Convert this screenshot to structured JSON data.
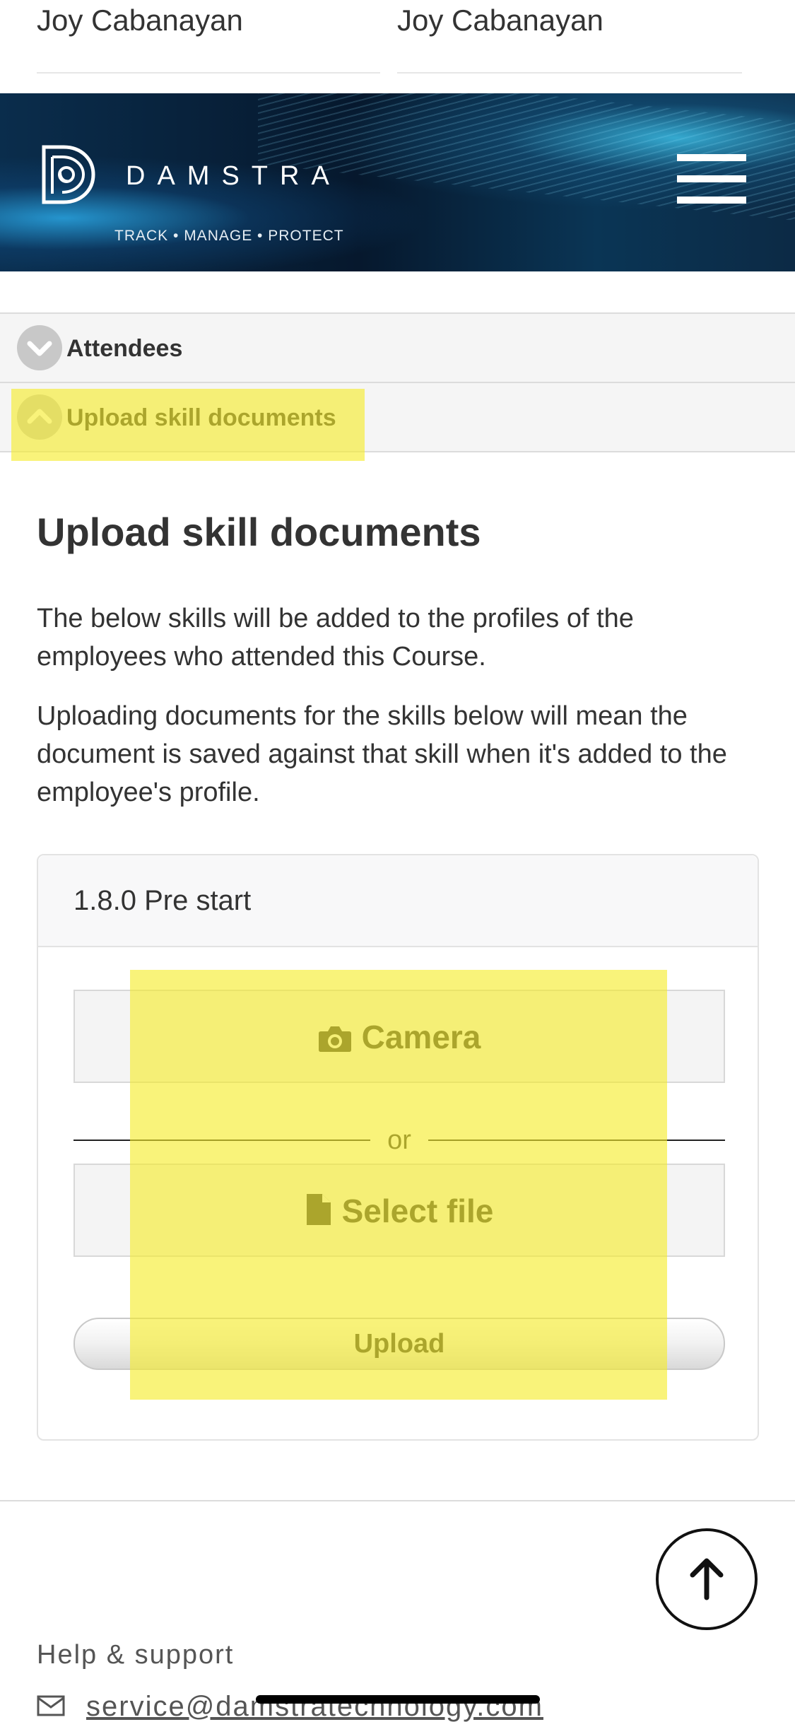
{
  "attendees_top": {
    "left_name": "Joy Cabanayan",
    "right_name": "Joy Cabanayan"
  },
  "header": {
    "brand": "DAMSTRA",
    "tagline": "TRACK • MANAGE • PROTECT",
    "menu_icon": "hamburger-menu-icon",
    "logo_icon": "damstra-logo-mark"
  },
  "accordion": {
    "items": [
      {
        "label": "Attendees",
        "icon": "chevron-down-icon",
        "expanded": false
      },
      {
        "label": "Upload skill documents",
        "icon": "chevron-up-icon",
        "expanded": true
      }
    ]
  },
  "main": {
    "title": "Upload skill documents",
    "paragraph_1": "The below skills will be added to the profiles of the employees who attended this Course.",
    "paragraph_2": "Uploading documents for the skills below will mean the document is saved against that skill when it's added to the employee's profile."
  },
  "skill_panel": {
    "title": "1.8.0 Pre start",
    "camera_label": "Camera",
    "camera_icon": "camera-icon",
    "divider_text": "or",
    "select_file_label": "Select file",
    "select_file_icon": "file-icon",
    "upload_label": "Upload"
  },
  "footer": {
    "help_title": "Help & support",
    "email": "service@damstratechnology.com",
    "email_icon": "envelope-icon",
    "scroll_top_icon": "arrow-up-icon"
  },
  "colors": {
    "highlight": "#f5ec28",
    "banner_dark": "#06182d",
    "banner_accent": "#3cbee6",
    "text": "#333333"
  }
}
